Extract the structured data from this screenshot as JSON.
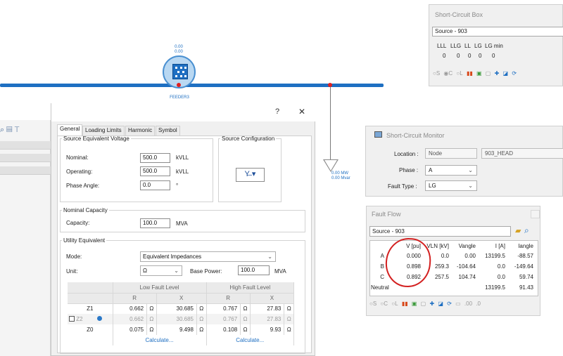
{
  "diagram": {
    "feeder_value_top": "0.00",
    "feeder_value_bottom": "0.00",
    "feeder_name": "FEEDER3",
    "load_mw": "0.00 MW",
    "load_mvar": "0.00 Mvar",
    "colors": {
      "bus": "#1e6fc2",
      "node_dot": "#e02020"
    }
  },
  "left_panel": {
    "icons": [
      "search-zoom-icon",
      "table-icon",
      "filter-icon"
    ]
  },
  "dialog": {
    "help_label": "?",
    "close_label": "✕",
    "tabs": [
      "General",
      "Loading Limits",
      "Harmonic",
      "Symbol"
    ],
    "active_tab": "General",
    "source_voltage": {
      "legend": "Source Equivalent Voltage",
      "nominal_label": "Nominal:",
      "nominal_value": "500.0",
      "nominal_unit": "kVLL",
      "operating_label": "Operating:",
      "operating_value": "500.0",
      "operating_unit": "kVLL",
      "phase_label": "Phase Angle:",
      "phase_value": "0.0",
      "phase_unit": "°"
    },
    "source_config": {
      "legend": "Source Configuration",
      "button_icon": "wye-grounded-icon"
    },
    "nominal_capacity": {
      "legend": "Nominal Capacity",
      "capacity_label": "Capacity:",
      "capacity_value": "100.0",
      "capacity_unit": "MVA"
    },
    "utility_equivalent": {
      "legend": "Utility Equivalent",
      "mode_label": "Mode:",
      "mode_value": "Equivalent Impedances",
      "unit_label": "Unit:",
      "unit_value": "Ω",
      "base_power_label": "Base Power:",
      "base_power_value": "100.0",
      "base_power_unit": "MVA"
    },
    "impedance_table": {
      "low_header": "Low Fault Level",
      "high_header": "High Fault Level",
      "col_r": "R",
      "col_x": "X",
      "ohm": "Ω",
      "calculate": "Calculate...",
      "rows": [
        {
          "name": "Z1",
          "low_r": "0.662",
          "low_x": "30.685",
          "high_r": "0.767",
          "high_x": "27.83"
        },
        {
          "name": "Z2",
          "low_r": "0.662",
          "low_x": "30.685",
          "high_r": "0.767",
          "high_x": "27.83"
        },
        {
          "name": "Z0",
          "low_r": "0.075",
          "low_x": "9.498",
          "high_r": "0.108",
          "high_x": "9.93"
        }
      ]
    }
  },
  "sc_box": {
    "title": "Short-Circuit Box",
    "source": "Source - 903",
    "headers": [
      "LLL",
      "LLG",
      "LL",
      "LG",
      "LG min"
    ],
    "values": [
      "0",
      "0",
      "0",
      "0",
      "0"
    ]
  },
  "sc_monitor": {
    "title": "Short-Circuit Monitor",
    "location_label": "Location :",
    "location_type": "Node",
    "location_value": "903_HEAD",
    "phase_label": "Phase :",
    "phase_value": "A",
    "fault_type_label": "Fault Type :",
    "fault_type_value": "LG"
  },
  "fault_flow": {
    "title": "Fault Flow",
    "source": "Source - 903",
    "headers": [
      "V [pu]",
      "VLN [kV]",
      "Vangle",
      "I [A]",
      "Iangle"
    ],
    "rows": [
      {
        "phase": "A",
        "v_pu": "0.000",
        "vln": "0.0",
        "vangle": "0.00",
        "i": "13199.5",
        "iangle": "-88.57"
      },
      {
        "phase": "B",
        "v_pu": "0.898",
        "vln": "259.3",
        "vangle": "-104.64",
        "i": "0.0",
        "iangle": "-149.64"
      },
      {
        "phase": "C",
        "v_pu": "0.892",
        "vln": "257.5",
        "vangle": "104.74",
        "i": "0.0",
        "iangle": "59.74"
      },
      {
        "phase": "Neutral",
        "v_pu": "",
        "vln": "",
        "vangle": "",
        "i": "13199.5",
        "iangle": "91.43"
      }
    ]
  },
  "toolbar": {
    "radio_s": "S",
    "radio_c": "C",
    "radio_l": "L",
    "dec_more": ".00",
    "dec_less": ".0"
  },
  "annotation": {
    "color": "#d32020",
    "shape": "hand-drawn circle around V [pu] column"
  }
}
